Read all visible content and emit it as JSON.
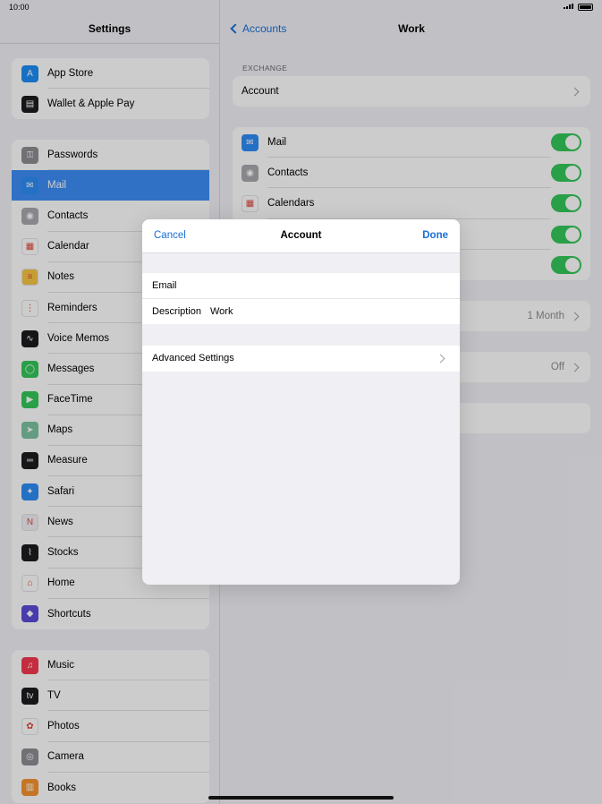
{
  "status": {
    "time": "10:00"
  },
  "sidebar": {
    "title": "Settings",
    "groups": [
      [
        {
          "label": "App Store",
          "icon": "app-store-icon",
          "color": "#1c8cf5",
          "glyph": "A"
        },
        {
          "label": "Wallet & Apple Pay",
          "icon": "wallet-icon",
          "color": "#1c1c1e",
          "glyph": "▤"
        }
      ],
      [
        {
          "label": "Passwords",
          "icon": "key-icon",
          "color": "#8e8e93",
          "glyph": "⚿"
        },
        {
          "label": "Mail",
          "icon": "mail-icon",
          "color": "#2e8cf6",
          "glyph": "✉",
          "selected": true
        },
        {
          "label": "Contacts",
          "icon": "contacts-icon",
          "color": "#a9a9ae",
          "glyph": "◉"
        },
        {
          "label": "Calendar",
          "icon": "calendar-icon",
          "color": "#ffffff",
          "glyph": "▦"
        },
        {
          "label": "Notes",
          "icon": "notes-icon",
          "color": "#f7c744",
          "glyph": "≡"
        },
        {
          "label": "Reminders",
          "icon": "reminders-icon",
          "color": "#ffffff",
          "glyph": "⋮"
        },
        {
          "label": "Voice Memos",
          "icon": "voice-memos-icon",
          "color": "#1c1c1e",
          "glyph": "∿"
        },
        {
          "label": "Messages",
          "icon": "messages-icon",
          "color": "#34c759",
          "glyph": "◯"
        },
        {
          "label": "FaceTime",
          "icon": "facetime-icon",
          "color": "#34c759",
          "glyph": "▶"
        },
        {
          "label": "Maps",
          "icon": "maps-icon",
          "color": "#7cc4a0",
          "glyph": "➤"
        },
        {
          "label": "Measure",
          "icon": "measure-icon",
          "color": "#1c1c1e",
          "glyph": "═"
        },
        {
          "label": "Safari",
          "icon": "safari-icon",
          "color": "#2e8cf6",
          "glyph": "✦"
        },
        {
          "label": "News",
          "icon": "news-icon",
          "color": "#f2f2f7",
          "glyph": "N"
        },
        {
          "label": "Stocks",
          "icon": "stocks-icon",
          "color": "#1c1c1e",
          "glyph": "⌇"
        },
        {
          "label": "Home",
          "icon": "home-icon",
          "color": "#ffffff",
          "glyph": "⌂"
        },
        {
          "label": "Shortcuts",
          "icon": "shortcuts-icon",
          "color": "#5a4bd8",
          "glyph": "◆"
        }
      ],
      [
        {
          "label": "Music",
          "icon": "music-icon",
          "color": "#f5394f",
          "glyph": "♫"
        },
        {
          "label": "TV",
          "icon": "tv-icon",
          "color": "#1c1c1e",
          "glyph": "tv"
        },
        {
          "label": "Photos",
          "icon": "photos-icon",
          "color": "#ffffff",
          "glyph": "✿"
        },
        {
          "label": "Camera",
          "icon": "camera-icon",
          "color": "#8e8e93",
          "glyph": "◎"
        },
        {
          "label": "Books",
          "icon": "books-icon",
          "color": "#f7932e",
          "glyph": "▥"
        }
      ]
    ]
  },
  "detail": {
    "back_label": "Accounts",
    "title": "Work",
    "section_label": "EXCHANGE",
    "account_label": "Account",
    "toggles": [
      {
        "label": "Mail",
        "icon": "mail-icon",
        "color": "#2e8cf6",
        "glyph": "✉"
      },
      {
        "label": "Contacts",
        "icon": "contacts-icon",
        "color": "#a9a9ae",
        "glyph": "◉"
      },
      {
        "label": "Calendars",
        "icon": "calendar-icon",
        "color": "#ffffff",
        "glyph": "▦"
      },
      {
        "label": "",
        "icon": "",
        "color": "#ffffff",
        "glyph": ""
      },
      {
        "label": "",
        "icon": "",
        "color": "#ffffff",
        "glyph": ""
      }
    ],
    "sync_value": "1 Month",
    "off_value": "Off"
  },
  "modal": {
    "cancel": "Cancel",
    "title": "Account",
    "done": "Done",
    "email_label": "Email",
    "email_value": "",
    "description_label": "Description",
    "description_value": "Work",
    "advanced_label": "Advanced Settings"
  }
}
